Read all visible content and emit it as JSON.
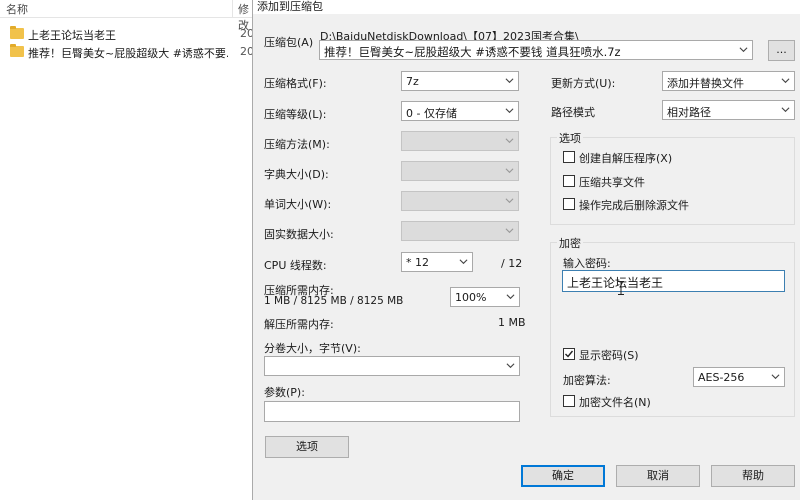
{
  "explorer": {
    "col_name": "名称",
    "col_modified": "修改",
    "files": [
      {
        "name": "上老王论坛当老王",
        "date": "20"
      },
      {
        "name": "推荐！巨臀美女~屁股超级大 #诱惑不要...",
        "date": "20"
      }
    ]
  },
  "dialog": {
    "title": "添加到压缩包",
    "archive_label": "压缩包(A)",
    "archive_dir": "D:\\BaiduNetdiskDownload\\【07】2023国考合集\\",
    "archive_name": "推荐！巨臀美女~屁股超级大 #诱惑不要钱 道具狂喷水.7z",
    "browse_label": "...",
    "format_label": "压缩格式(F):",
    "format_value": "7z",
    "level_label": "压缩等级(L):",
    "level_value": "0 - 仅存储",
    "method_label": "压缩方法(M):",
    "dict_label": "字典大小(D):",
    "word_label": "单词大小(W):",
    "solid_label": "固实数据大小:",
    "cpu_label": "CPU 线程数:",
    "cpu_value": "* 12",
    "cpu_max": "/ 12",
    "mem_comp_label": "压缩所需内存:",
    "mem_comp_detail": "1 MB / 8125 MB / 8125 MB",
    "mem_percent": "100%",
    "mem_decomp_label": "解压所需内存:",
    "mem_decomp_value": "1 MB",
    "split_label": "分卷大小，字节(V):",
    "params_label": "参数(P):",
    "options_button": "选项",
    "update_label": "更新方式(U):",
    "update_value": "添加并替换文件",
    "path_label": "路径模式",
    "path_value": "相对路径",
    "options_group": "选项",
    "opt_sfx": "创建自解压程序(X)",
    "opt_shared": "压缩共享文件",
    "opt_delete": "操作完成后删除源文件",
    "encrypt_group": "加密",
    "password_label": "输入密码:",
    "password_value": "上老王论坛当老王",
    "show_password": "显示密码(S)",
    "enc_method_label": "加密算法:",
    "enc_method_value": "AES-256",
    "encrypt_names": "加密文件名(N)",
    "ok": "确定",
    "cancel": "取消",
    "help": "帮助"
  }
}
